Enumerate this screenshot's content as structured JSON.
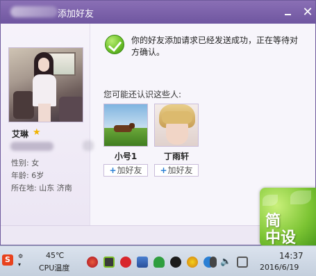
{
  "window": {
    "title": "添加好友",
    "message": "你的好友添加请求已经发送成功，正在等待对方确认。",
    "maybe_know_label": "您可能还认识这些人:"
  },
  "profile": {
    "nickname": "艾琳",
    "info": {
      "gender": "性别: 女",
      "age": "年龄: 6岁",
      "location": "所在地: 山东  济南"
    }
  },
  "suggestions": [
    {
      "name": "小号1",
      "add_label": "加好友"
    },
    {
      "name": "丁雨轩",
      "add_label": "加好友"
    }
  ],
  "brand": {
    "line1": "简",
    "line2": "中设"
  },
  "taskbar": {
    "sogou": "S",
    "temperature": "45℃",
    "cpu_label": "CPU温度",
    "time": "14:37",
    "date": "2016/6/19"
  },
  "icons": {
    "success": "check-circle-icon",
    "star": "star-icon",
    "plus": "plus-icon"
  },
  "colors": {
    "titlebar": "#7a5fa9",
    "success": "#6ec22a",
    "brand": "#7cc433",
    "plus": "#2a7fd4"
  }
}
